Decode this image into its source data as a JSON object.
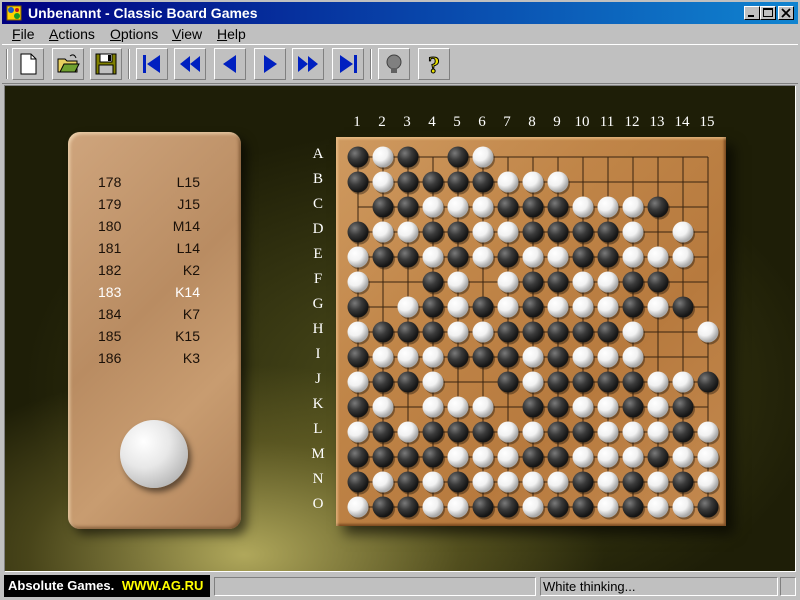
{
  "window": {
    "title": "Unbenannt - Classic Board Games",
    "controls": [
      "minimize",
      "maximize",
      "close"
    ]
  },
  "menu": [
    {
      "label": "File",
      "mnemonic": "F",
      "rest": "ile"
    },
    {
      "label": "Actions",
      "mnemonic": "A",
      "rest": "ctions"
    },
    {
      "label": "Options",
      "mnemonic": "O",
      "rest": "ptions"
    },
    {
      "label": "View",
      "mnemonic": "V",
      "rest": "iew"
    },
    {
      "label": "Help",
      "mnemonic": "H",
      "rest": "elp"
    }
  ],
  "toolbar": [
    {
      "icon": "new-document-icon"
    },
    {
      "icon": "open-folder-icon"
    },
    {
      "icon": "save-floppy-icon"
    },
    {
      "icon": "first-move-icon"
    },
    {
      "icon": "fast-back-icon"
    },
    {
      "icon": "step-back-icon"
    },
    {
      "icon": "step-forward-icon"
    },
    {
      "icon": "fast-forward-icon"
    },
    {
      "icon": "last-move-icon"
    },
    {
      "icon": "hint-lightbulb-icon"
    },
    {
      "icon": "help-question-icon"
    }
  ],
  "moves": [
    {
      "num": "178",
      "coord": "L15"
    },
    {
      "num": "179",
      "coord": "J15"
    },
    {
      "num": "180",
      "coord": "M14"
    },
    {
      "num": "181",
      "coord": "L14"
    },
    {
      "num": "182",
      "coord": "K2"
    },
    {
      "num": "183",
      "coord": "K14",
      "highlight": true
    },
    {
      "num": "184",
      "coord": "K7"
    },
    {
      "num": "185",
      "coord": "K15"
    },
    {
      "num": "186",
      "coord": "K3"
    }
  ],
  "turn_stone": "white",
  "board": {
    "size": 15,
    "columns": [
      "1",
      "2",
      "3",
      "4",
      "5",
      "6",
      "7",
      "8",
      "9",
      "10",
      "11",
      "12",
      "13",
      "14",
      "15"
    ],
    "rows": [
      "A",
      "B",
      "C",
      "D",
      "E",
      "F",
      "G",
      "H",
      "I",
      "J",
      "K",
      "L",
      "M",
      "N",
      "O"
    ],
    "legend": {
      "B": "black",
      "W": "white",
      ".": "empty"
    },
    "stones": [
      "BWB.BW.........",
      "BWBBBBWWW......",
      ".BBWWWBBBWWWB..",
      "BWWBBWWBBBBW.W.",
      "WBBWBWBWWBBWWW.",
      "W..BW.WBBWWBB..",
      "B.WBWBWBWWWBWB.",
      "WBBBWWBBBBBW..W",
      "BWWWBBBWBWWW...",
      "WBBW..BWBBBBWWB",
      "BW.WWW.BBWWBWB.",
      "WBWBBBWWBBWWWBW",
      "BBBBWWWBBWWWBWW",
      "BWBWBWWWWBWBWBW",
      "WBBWWBBWBBWBWWB"
    ],
    "colors": {
      "black": "#3a3a3a",
      "white": "#f2f2f2",
      "wood": "#c08548",
      "line": "#3a2410"
    }
  },
  "status": {
    "logo_prefix": "Absolute Games. ",
    "logo_site": "WWW.AG.RU",
    "message": "White thinking..."
  }
}
